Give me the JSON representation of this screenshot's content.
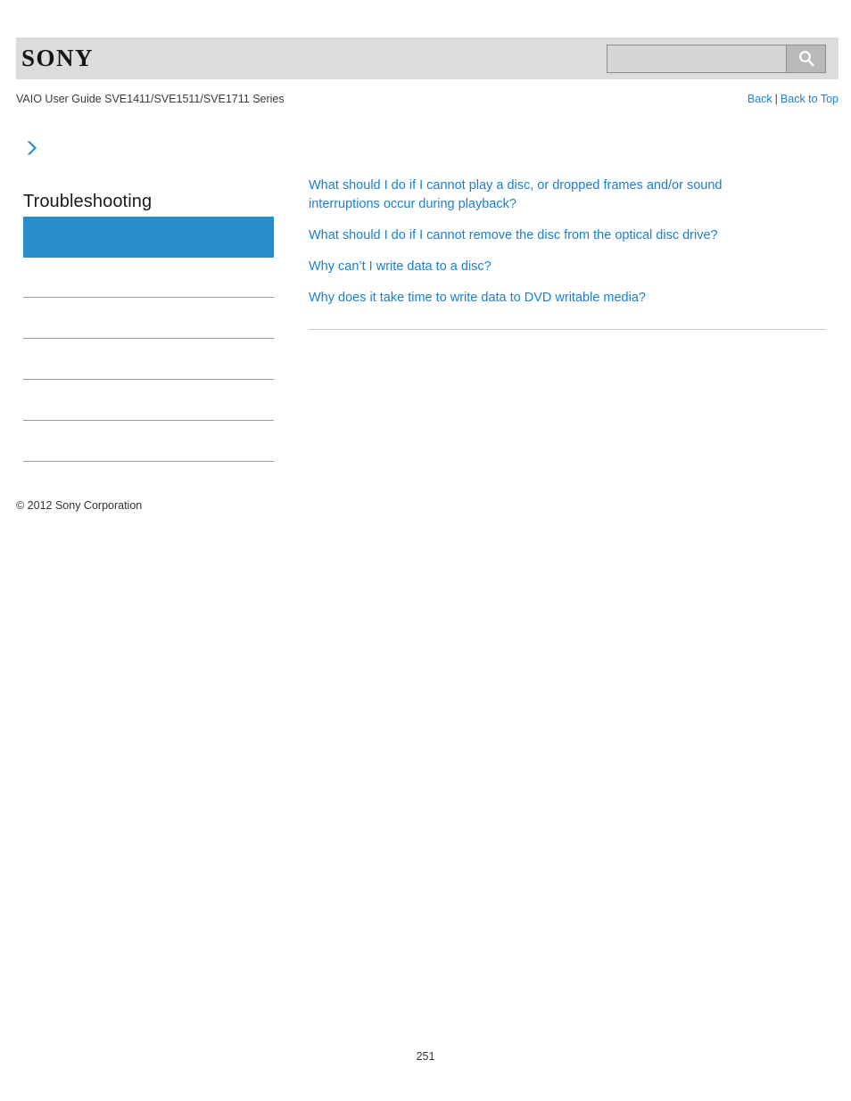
{
  "header": {
    "logo_text": "SONY",
    "search": {
      "value": "",
      "placeholder": "",
      "icon": "search-icon"
    }
  },
  "subheader": {
    "guide_title": "VAIO User Guide SVE1411/SVE1511/SVE1711 Series",
    "back_label": "Back",
    "separator": "|",
    "back_to_top_label": "Back to Top"
  },
  "sidebar": {
    "chevron_icon": "chevron-right-icon",
    "section_title": "Troubleshooting",
    "selected_item_label": "",
    "blank_items": [
      "",
      "",
      "",
      "",
      ""
    ],
    "selected_color": "#2b8cca"
  },
  "content": {
    "links": [
      "What should I do if I cannot play a disc, or dropped frames and/or sound interruptions occur during playback?",
      "What should I do if I cannot remove the disc from the optical disc drive?",
      "Why can’t I write data to a disc?",
      "Why does it take time to write data to DVD writable media?"
    ],
    "link_color": "#1a7fd4"
  },
  "footer": {
    "copyright": "© 2012 Sony Corporation",
    "page_number": "251"
  }
}
